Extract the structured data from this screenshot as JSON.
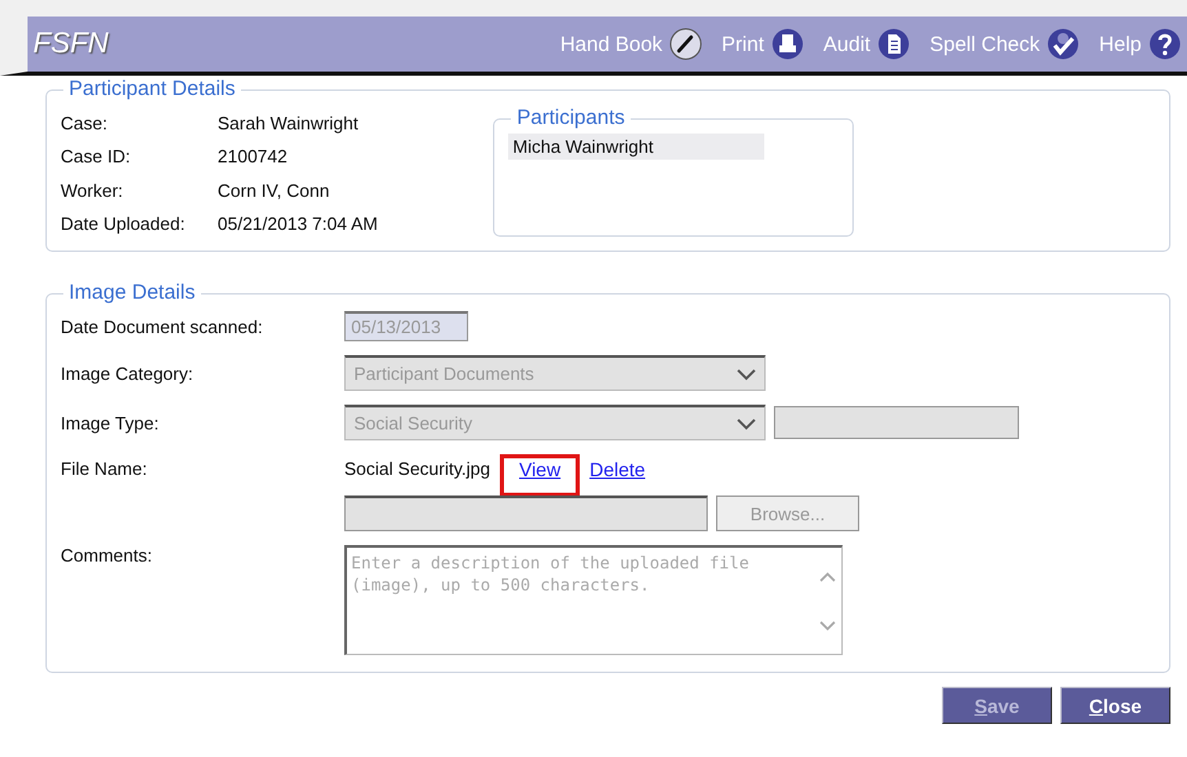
{
  "header": {
    "title": "FSFN",
    "tools": [
      {
        "label": "Hand Book",
        "kind": "pen"
      },
      {
        "label": "Print",
        "kind": "printer"
      },
      {
        "label": "Audit",
        "kind": "document"
      },
      {
        "label": "Spell Check",
        "kind": "spellcheck"
      },
      {
        "label": "Help",
        "kind": "help"
      }
    ]
  },
  "participant_details": {
    "legend": "Participant Details",
    "fields": [
      {
        "label": "Case:",
        "value": "Sarah Wainwright"
      },
      {
        "label": "Case ID:",
        "value": "2100742"
      },
      {
        "label": "Worker:",
        "value": "Corn IV, Conn"
      },
      {
        "label": "Date Uploaded:",
        "value": "05/21/2013 7:04 AM"
      }
    ],
    "participants": {
      "legend": "Participants",
      "items": [
        {
          "name": "Micha Wainwright",
          "selected": true
        }
      ]
    }
  },
  "image_details": {
    "legend": "Image Details",
    "date_scanned": {
      "label": "Date Document scanned:",
      "value": "05/13/2013",
      "disabled": true
    },
    "category": {
      "label": "Image Category:",
      "value": "Participant Documents",
      "disabled": true
    },
    "type": {
      "label": "Image Type:",
      "value": "Social Security",
      "disabled": true
    },
    "file_name": {
      "label": "File Name:",
      "value": "Social Security.jpg",
      "links": [
        {
          "label": "View",
          "highlighted": true
        },
        {
          "label": "Delete",
          "highlighted": false
        }
      ],
      "browse": {
        "label": "Browse...",
        "disabled": true
      }
    },
    "comments": {
      "label": "Comments:",
      "placeholder": "Enter a description of the uploaded file (image), up to 500 characters."
    }
  },
  "buttons": [
    {
      "label": "Save",
      "disabled": true
    },
    {
      "label": "Close",
      "disabled": false
    }
  ]
}
